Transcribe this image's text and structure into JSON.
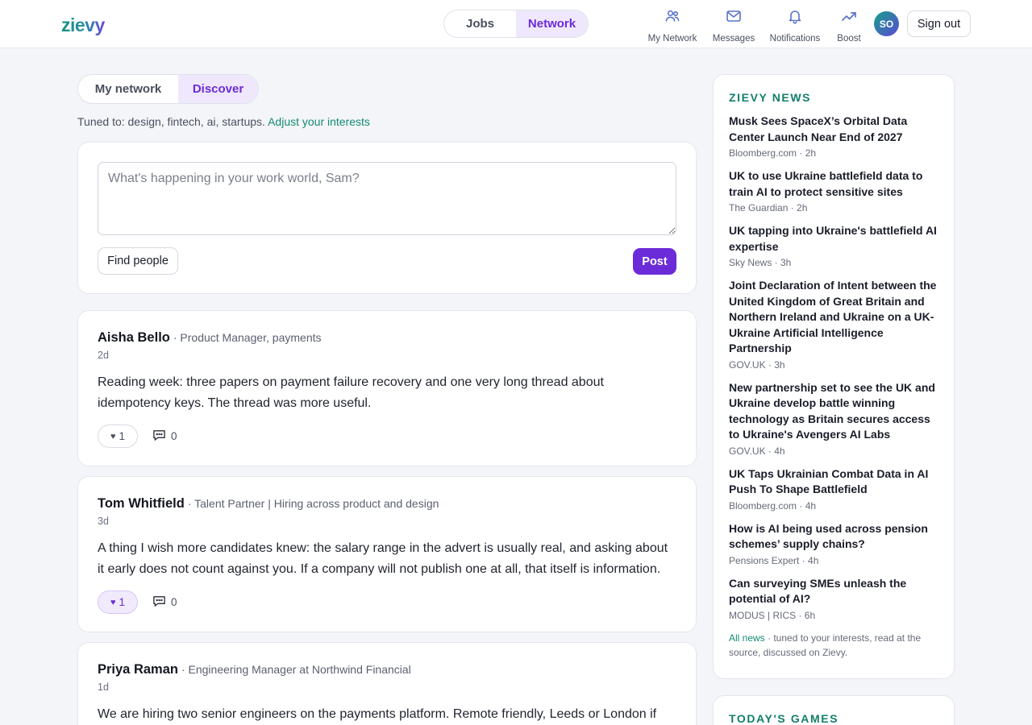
{
  "header": {
    "logo": "zievy",
    "mode_tabs": [
      {
        "label": "Jobs",
        "active": false
      },
      {
        "label": "Network",
        "active": true
      }
    ],
    "nav": [
      {
        "label": "My Network",
        "icon": "people-icon"
      },
      {
        "label": "Messages",
        "icon": "envelope-icon"
      },
      {
        "label": "Notifications",
        "icon": "bell-icon"
      },
      {
        "label": "Boost",
        "icon": "trend-up-icon"
      }
    ],
    "avatar_initials": "SO",
    "sign_out": "Sign out"
  },
  "feed": {
    "tabs": [
      {
        "label": "My network",
        "active": false
      },
      {
        "label": "Discover",
        "active": true
      }
    ],
    "tuned_prefix": "Tuned to: design, fintech, ai, startups.",
    "adjust_link": "Adjust your interests"
  },
  "composer": {
    "placeholder": "What's happening in your work world, Sam?",
    "find_people": "Find people",
    "post": "Post"
  },
  "posts": [
    {
      "name": "Aisha Bello",
      "role": "· Product Manager, payments",
      "time": "2d",
      "body": "Reading week: three papers on payment failure recovery and one very long thread about idempotency keys. The thread was more useful.",
      "likes": "1",
      "liked": false,
      "comments": "0"
    },
    {
      "name": "Tom Whitfield",
      "role": "· Talent Partner | Hiring across product and design",
      "time": "3d",
      "body": "A thing I wish more candidates knew: the salary range in the advert is usually real, and asking about it early does not count against you. If a company will not publish one at all, that itself is information.",
      "likes": "1",
      "liked": true,
      "comments": "0"
    },
    {
      "name": "Priya Raman",
      "role": "· Engineering Manager at Northwind Financial",
      "time": "1d",
      "body": "We are hiring two senior engineers on the payments platform. Remote friendly, Leeds or London if you"
    }
  ],
  "news": {
    "title": "ZIEVY NEWS",
    "items": [
      {
        "headline": "Musk Sees SpaceX’s Orbital Data Center Launch Near End of 2027",
        "meta": "Bloomberg.com · 2h"
      },
      {
        "headline": "UK to use Ukraine battlefield data to train AI to protect sensitive sites",
        "meta": "The Guardian · 2h"
      },
      {
        "headline": "UK tapping into Ukraine's battlefield AI expertise",
        "meta": "Sky News · 3h"
      },
      {
        "headline": "Joint Declaration of Intent between the United Kingdom of Great Britain and Northern Ireland and Ukraine on a UK-Ukraine Artificial Intelligence Partnership",
        "meta": "GOV.UK · 3h"
      },
      {
        "headline": "New partnership set to see the UK and Ukraine develop battle winning technology as Britain secures access to Ukraine's Avengers AI Labs",
        "meta": "GOV.UK · 4h"
      },
      {
        "headline": "UK Taps Ukrainian Combat Data in AI Push To Shape Battlefield",
        "meta": "Bloomberg.com · 4h"
      },
      {
        "headline": "How is AI being used across pension schemes’ supply chains?",
        "meta": "Pensions Expert · 4h"
      },
      {
        "headline": "Can surveying SMEs unleash the potential of AI?",
        "meta": "MODUS | RICS · 6h"
      }
    ],
    "footer_link": "All news",
    "footer_text": " · tuned to your interests, read at the source, discussed on Zievy."
  },
  "games": {
    "title": "TODAY'S GAMES"
  },
  "colors": {
    "accent_purple": "#6c2bd9",
    "accent_teal": "#127e6b",
    "page_bg": "#f4f5f8"
  }
}
